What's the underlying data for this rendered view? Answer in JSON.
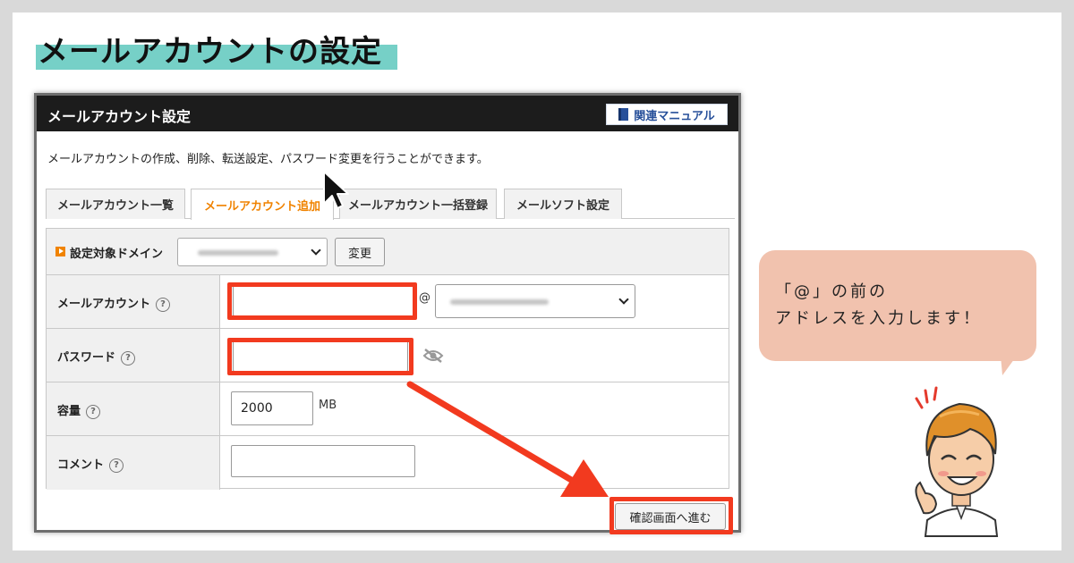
{
  "headline": "メールアカウントの設定",
  "panel": {
    "title": "メールアカウント設定",
    "manual_button": "関連マニュアル",
    "description": "メールアカウントの作成、削除、転送設定、パスワード変更を行うことができます。"
  },
  "tabs": [
    {
      "label": "メールアカウント一覧",
      "active": false
    },
    {
      "label": "メールアカウント追加",
      "active": true
    },
    {
      "label": "メールアカウント一括登録",
      "active": false
    },
    {
      "label": "メールソフト設定",
      "active": false
    }
  ],
  "form": {
    "domain_label": "設定対象ドメイン",
    "change_button": "変更",
    "rows": {
      "account": {
        "label": "メールアカウント",
        "at": "@"
      },
      "password": {
        "label": "パスワード"
      },
      "capacity": {
        "label": "容量",
        "value": "2000",
        "unit": "MB"
      },
      "comment": {
        "label": "コメント"
      }
    },
    "help_glyph": "?",
    "confirm_button": "確認画面へ進む"
  },
  "bubble": {
    "line1": "「@」の前の",
    "line2": "アドレスを入力します！"
  },
  "colors": {
    "accent_teal": "#76d0c7",
    "highlight_red": "#f23a1f",
    "active_tab_orange": "#f08300",
    "bubble_pink": "#f1c2ae",
    "header_dark": "#1c1c1c"
  },
  "icons": [
    "book-icon",
    "play-marker-icon",
    "help-icon",
    "chevron-down-icon",
    "eye-off-icon",
    "cursor-icon",
    "arrow-icon",
    "mascot-illustration"
  ]
}
